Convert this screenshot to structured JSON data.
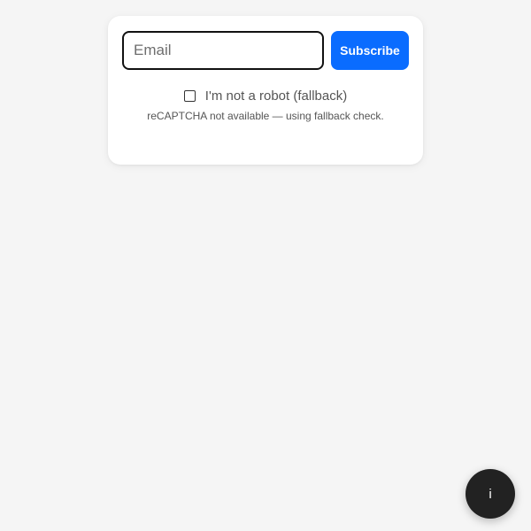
{
  "subscribe_form": {
    "email_placeholder": "Email",
    "email_value": "",
    "subscribe_label": "Subscribe"
  },
  "captcha": {
    "checkbox_label": "I'm not a robot (fallback)",
    "checked": false,
    "note": "reCAPTCHA not available — using fallback check."
  },
  "info_button": {
    "label": "i"
  },
  "colors": {
    "page_background": "#f5f5f5",
    "card_background": "#ffffff",
    "accent": "#0a6cff",
    "fab_background": "#222222"
  }
}
